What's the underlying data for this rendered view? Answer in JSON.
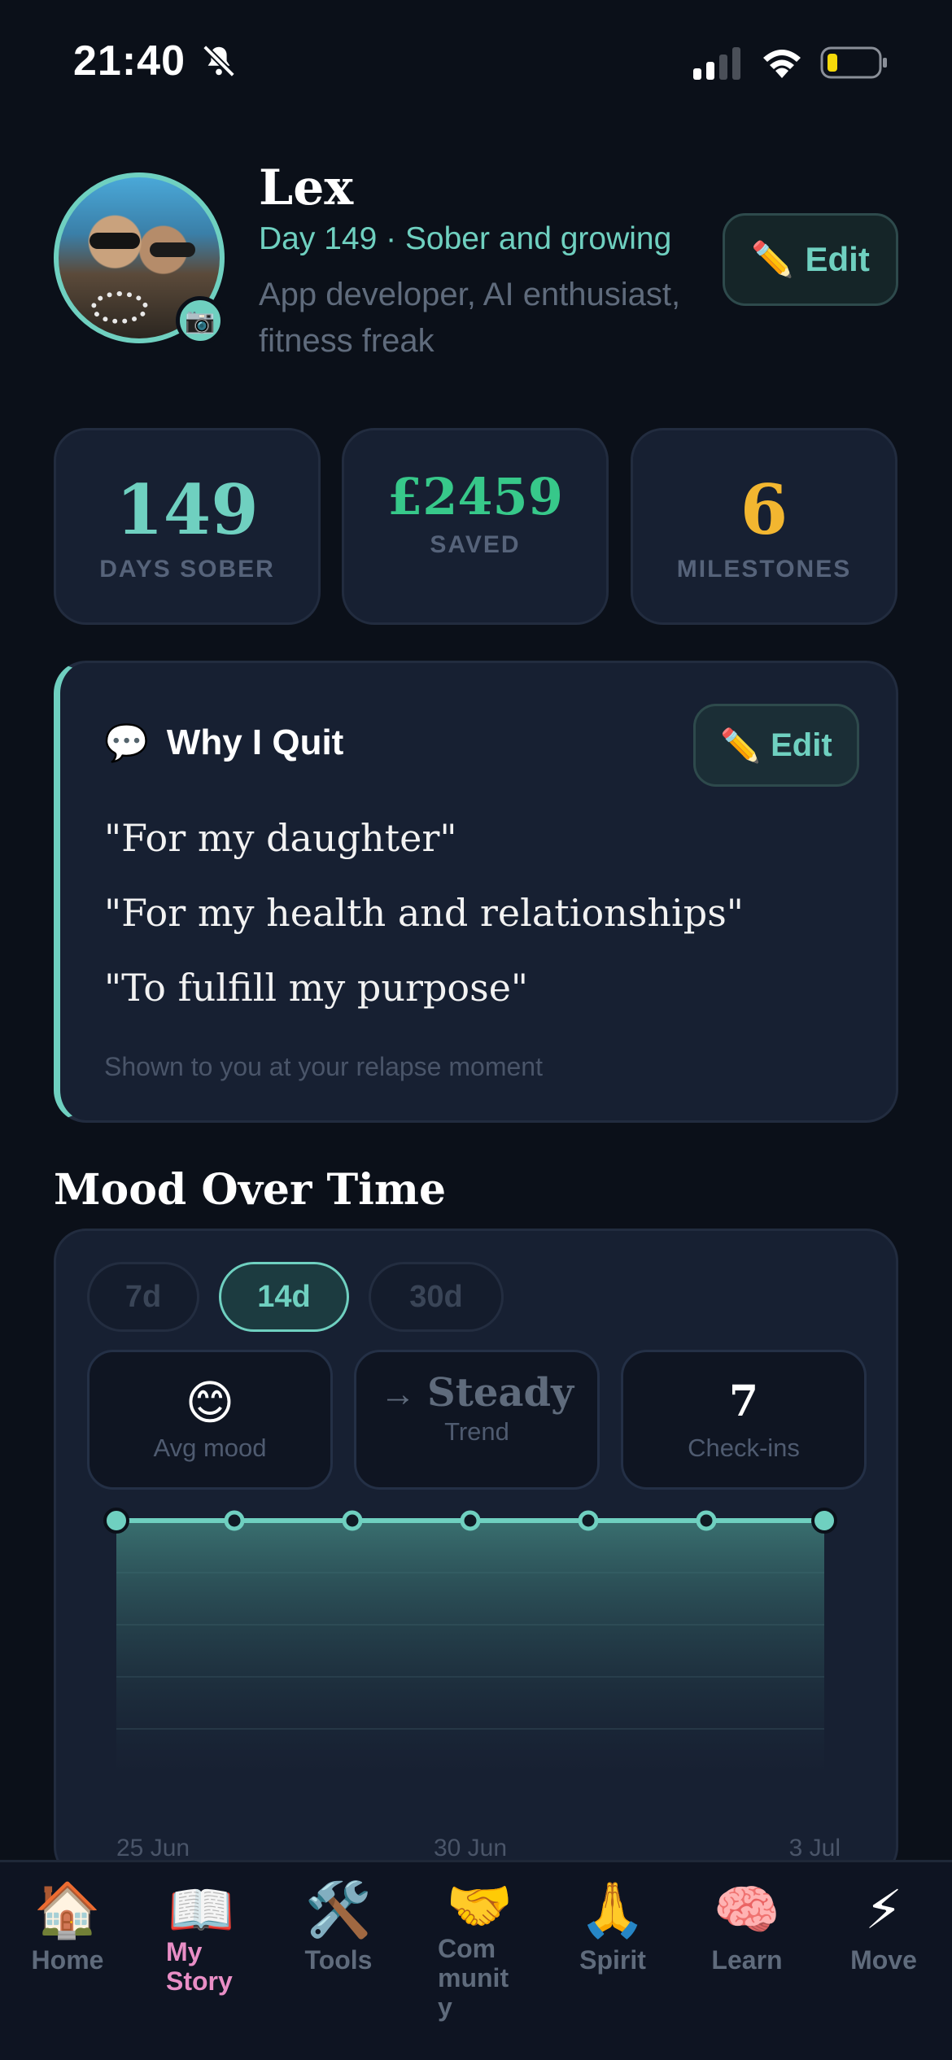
{
  "status": {
    "time": "21:40"
  },
  "profile": {
    "name": "Lex",
    "subtitle": "Day 149 · Sober and growing",
    "bio": "App developer, AI enthusiast, fitness freak",
    "edit_label": "Edit",
    "edit_icon": "✏️",
    "camera_icon": "📷"
  },
  "stats": [
    {
      "value": "149",
      "label": "DAYS SOBER",
      "color": "#6fd0c0"
    },
    {
      "value": "£2459",
      "label": "SAVED",
      "color": "#37c88a"
    },
    {
      "value": "6",
      "label": "MILESTONES",
      "color": "#f2b630"
    }
  ],
  "why": {
    "icon": "💬",
    "title": "Why I Quit",
    "edit_label": "Edit",
    "edit_icon": "✏️",
    "reasons": [
      "\"For my daughter\"",
      "\"For my health and relationships\"",
      "\"To fulfill my purpose\""
    ],
    "note": "Shown to you at your relapse moment"
  },
  "mood": {
    "title": "Mood Over Time",
    "ranges": [
      "7d",
      "14d",
      "30d"
    ],
    "selected_range": "14d",
    "avg": {
      "emoji": "😊",
      "label": "Avg mood"
    },
    "trend": {
      "arrow": "→",
      "value": "Steady",
      "label": "Trend"
    },
    "checkins": {
      "value": "7",
      "label": "Check-ins"
    }
  },
  "chart_data": {
    "type": "area",
    "x": [
      "25 Jun",
      "",
      "",
      "30 Jun",
      "",
      "",
      "3 Jul"
    ],
    "x_tick_labels": [
      "25 Jun",
      "30 Jun",
      "3 Jul"
    ],
    "series": [
      {
        "values": [
          5,
          5,
          5,
          5,
          5,
          5,
          5
        ]
      }
    ],
    "ylim": [
      0,
      5
    ],
    "grid": true,
    "color": "#6fd0c0"
  },
  "nav": {
    "items": [
      {
        "icon": "🏠",
        "label": "Home"
      },
      {
        "icon": "📖",
        "label": "My Story",
        "active": true
      },
      {
        "icon": "🛠️",
        "label": "Tools"
      },
      {
        "icon": "🤝",
        "label": "Community"
      },
      {
        "icon": "🙏",
        "label": "Spirit"
      },
      {
        "icon": "🧠",
        "label": "Learn"
      },
      {
        "icon": "⚡",
        "label": "Move"
      }
    ]
  }
}
